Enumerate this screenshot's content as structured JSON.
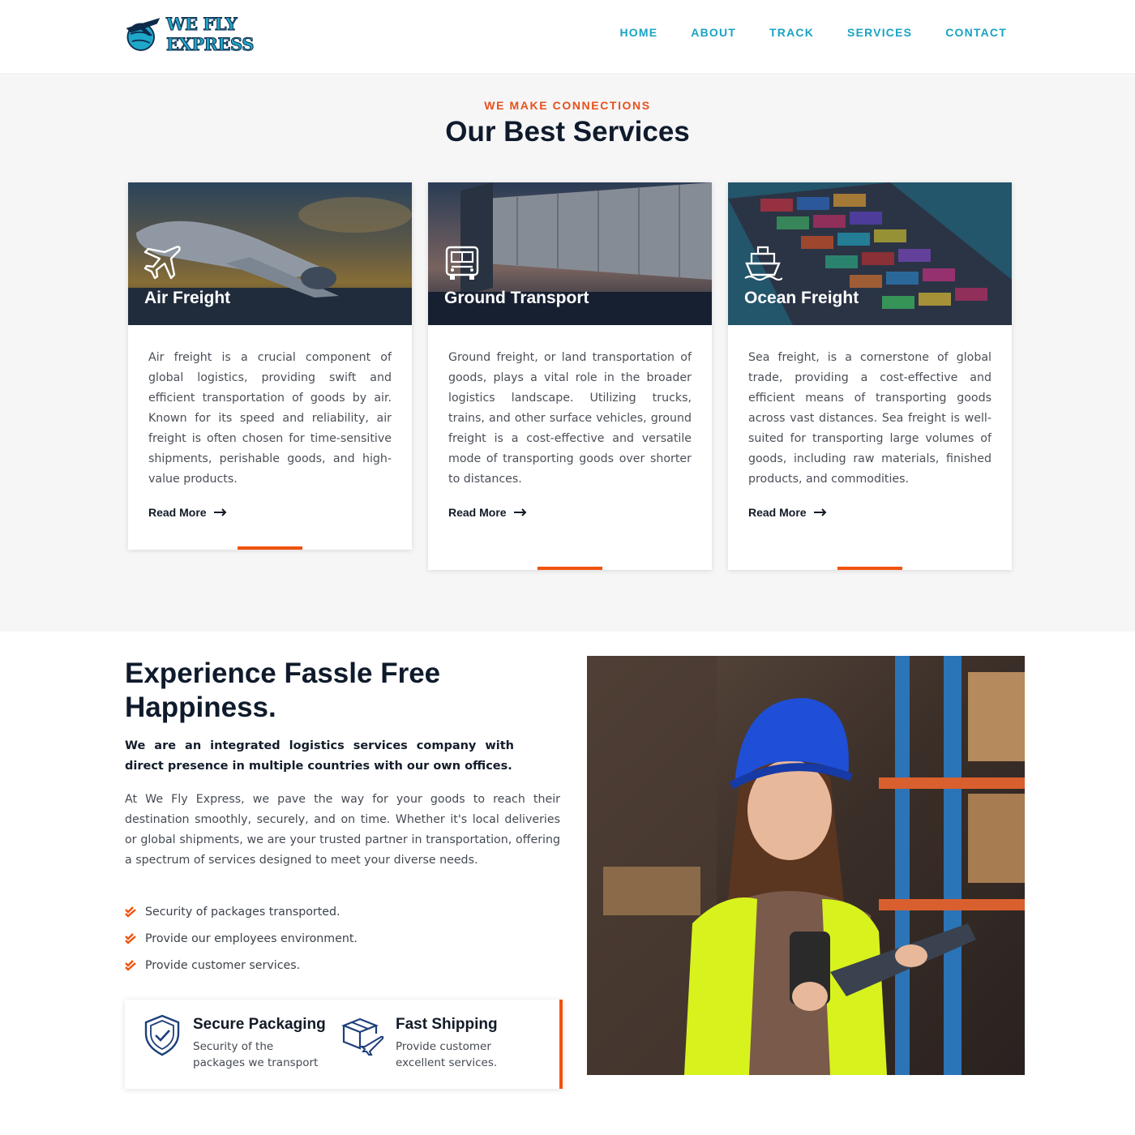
{
  "header": {
    "logo_text": "WE FLY EXPRESS",
    "nav": [
      "HOME",
      "ABOUT",
      "TRACK",
      "SERVICES",
      "CONTACT"
    ]
  },
  "services": {
    "eyebrow": "WE MAKE CONNECTIONS",
    "title": "Our Best Services",
    "cards": [
      {
        "title": "Air Freight",
        "icon": "airplane-icon",
        "text": "Air freight is a crucial component of global logistics, providing swift and efficient transportation of goods by air. Known for its speed and reliability, air freight is often chosen for time-sensitive shipments, perishable goods, and high-value products.",
        "link": "Read More"
      },
      {
        "title": "Ground Transport",
        "icon": "truck-icon",
        "text": "Ground freight, or land transportation of goods, plays a vital role in the broader logistics landscape. Utilizing trucks, trains, and other surface vehicles, ground freight is a cost-effective and versatile mode of transporting goods over shorter to distances.",
        "link": "Read More"
      },
      {
        "title": "Ocean Freight",
        "icon": "ship-icon",
        "text": "Sea freight, is a cornerstone of global trade, providing a cost-effective and efficient means of transporting goods across vast distances. Sea freight is well-suited for transporting large volumes of goods, including raw materials, finished products, and commodities.",
        "link": "Read More"
      }
    ]
  },
  "about": {
    "title": "Experience Fassle Free Happiness.",
    "lead": "We are an integrated logistics services company with direct presence in multiple countries with our own offices.",
    "text": "At We Fly Express, we pave the way for your goods to reach their destination smoothly, securely, and on time. Whether it's local deliveries or global shipments, we are your trusted partner in transportation, offering a spectrum of services designed to meet your diverse needs.",
    "checklist": [
      "Security of packages transported.",
      "Provide our employees environment.",
      "Provide customer services."
    ],
    "features": [
      {
        "title": "Secure Packaging",
        "text": "Security of the packages we transport",
        "icon": "shield-check-icon"
      },
      {
        "title": "Fast Shipping",
        "text": "Provide customer excellent services.",
        "icon": "box-plane-icon"
      }
    ]
  },
  "colors": {
    "accent": "#f0520f",
    "nav": "#19a3c4",
    "heading": "#0f1b2c"
  }
}
